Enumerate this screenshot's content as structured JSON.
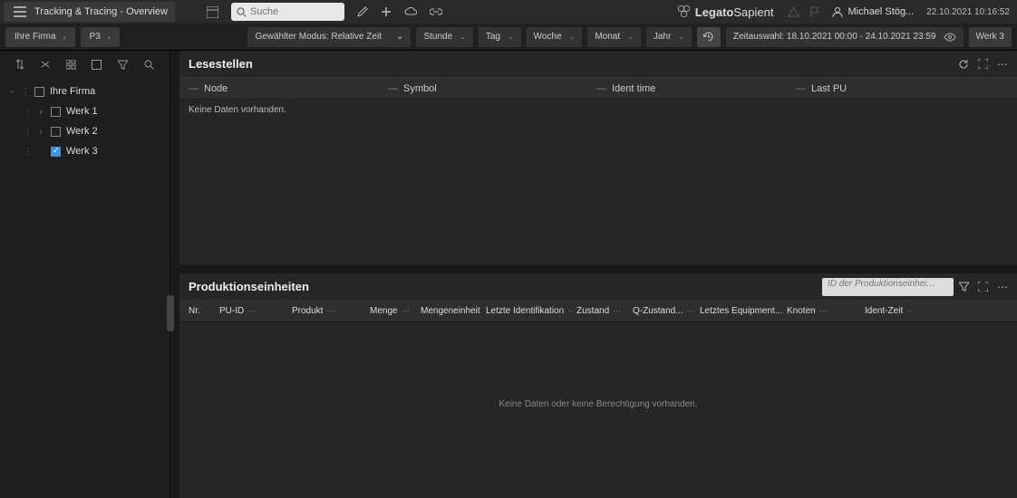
{
  "app": {
    "title": "Tracking & Tracing - Overview"
  },
  "search": {
    "placeholder": "Suche"
  },
  "logo": {
    "brand1": "Legato",
    "brand2": "Sapient"
  },
  "user": {
    "name": "Michael Stög..."
  },
  "datetime": "22.10.2021 10:16:52",
  "breadcrumbs": [
    {
      "label": "Ihre Firma"
    },
    {
      "label": "P3"
    }
  ],
  "mode": {
    "label": "Gewählter Modus: Relative Zeit"
  },
  "timeScales": [
    {
      "label": "Stunde"
    },
    {
      "label": "Tag"
    },
    {
      "label": "Woche"
    },
    {
      "label": "Monat"
    },
    {
      "label": "Jahr"
    }
  ],
  "timeRange": {
    "label": "Zeitauswahl: 18.10.2021 00:00 - 24.10.2021 23:59"
  },
  "contextBadge": "Werk 3",
  "tree": {
    "root": "Ihre Firma",
    "items": [
      {
        "label": "Werk 1",
        "checked": false,
        "expandable": true
      },
      {
        "label": "Werk 2",
        "checked": false,
        "expandable": true
      },
      {
        "label": "Werk 3",
        "checked": true,
        "expandable": false
      }
    ]
  },
  "panels": {
    "top": {
      "title": "Lesestellen",
      "columns": [
        "Node",
        "Symbol",
        "Ident time",
        "Last PU"
      ],
      "empty": "Keine Daten vorhanden."
    },
    "bottom": {
      "title": "Produktionseinheiten",
      "filterPlaceholder": "ID der Produktionseinhei...",
      "columns": [
        "Nr.",
        "PU-ID",
        "Produkt",
        "Menge",
        "Mengeneinheit",
        "Letzte Identifikation",
        "Zustand",
        "Q-Zustand...",
        "Letztes Equipment...",
        "Knoten",
        "Ident-Zeit"
      ],
      "empty": "Keine Daten oder keine Berechtigung vorhanden."
    }
  }
}
